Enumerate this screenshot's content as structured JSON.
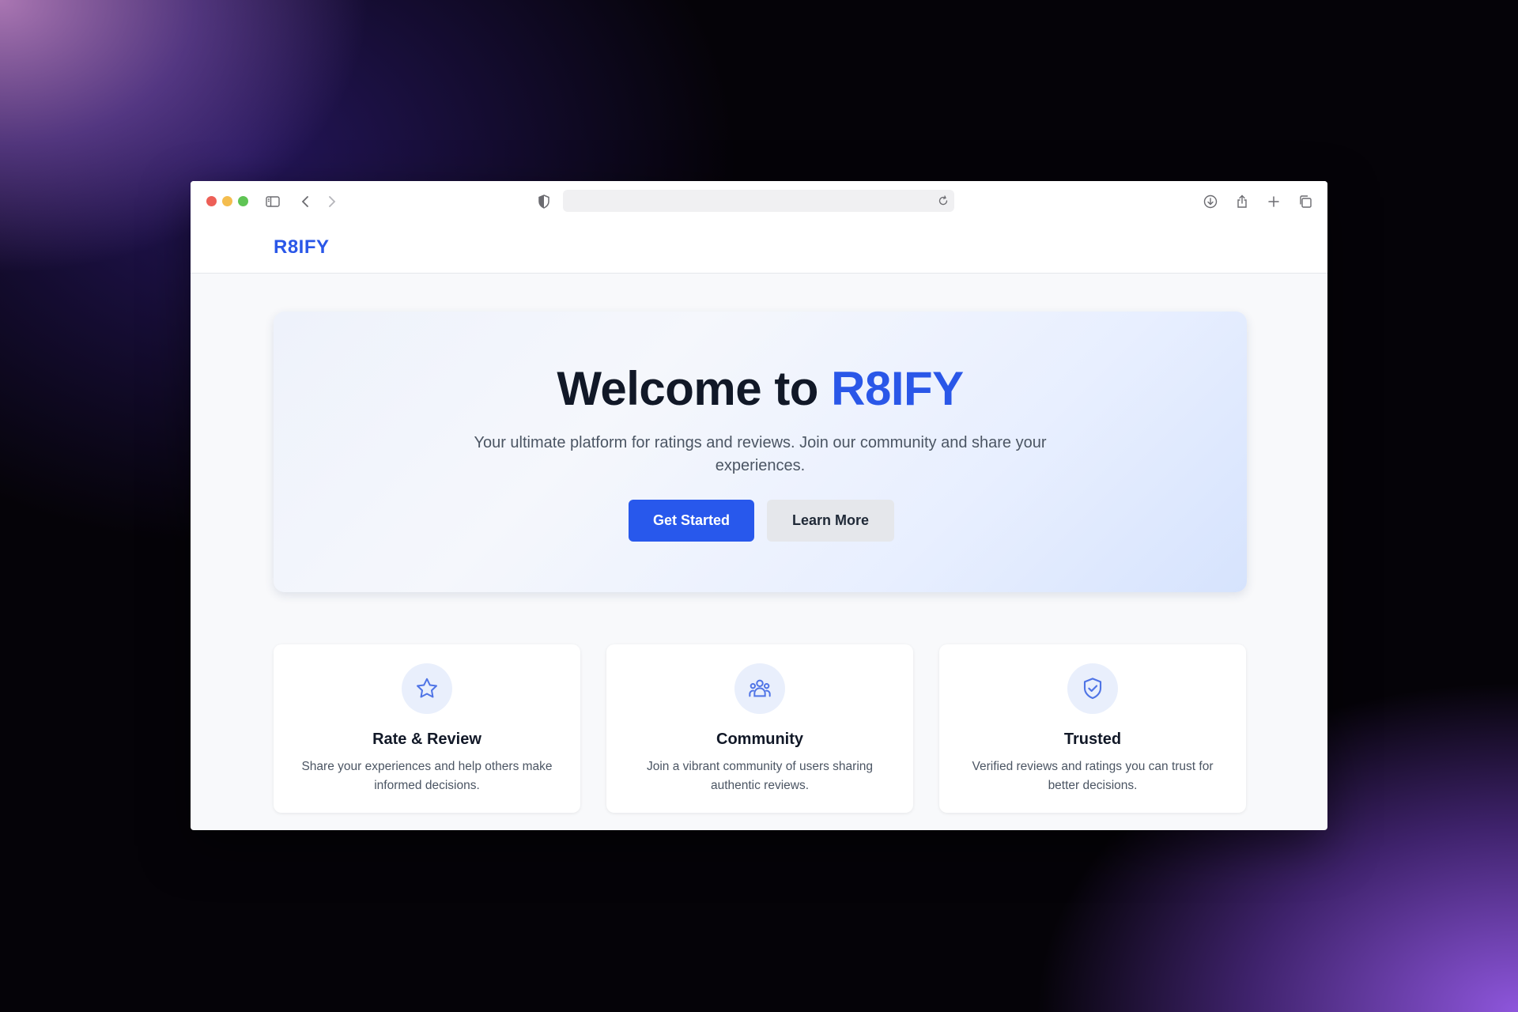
{
  "browser": {
    "url": "",
    "icons": [
      "sidebar-icon",
      "back-icon",
      "forward-icon",
      "privacy-shield-icon",
      "reload-icon",
      "download-icon",
      "share-icon",
      "new-tab-icon",
      "tabs-overview-icon"
    ]
  },
  "navbar": {
    "brand": "R8IFY"
  },
  "hero": {
    "title_prefix": "Welcome to ",
    "title_accent": "R8IFY",
    "subtitle": "Your ultimate platform for ratings and reviews. Join our community and share your experiences.",
    "primary_button": "Get Started",
    "secondary_button": "Learn More"
  },
  "features": [
    {
      "icon": "star-icon",
      "title": "Rate & Review",
      "text": "Share your experiences and help others make informed decisions."
    },
    {
      "icon": "users-icon",
      "title": "Community",
      "text": "Join a vibrant community of users sharing authentic reviews."
    },
    {
      "icon": "shield-check-icon",
      "title": "Trusted",
      "text": "Verified reviews and ratings you can trust for better decisions."
    }
  ],
  "colors": {
    "brand": "#2a57e8",
    "primary_button": "#2858ec",
    "secondary_button": "#e5e7eb",
    "icon_bg": "#e9effc"
  }
}
